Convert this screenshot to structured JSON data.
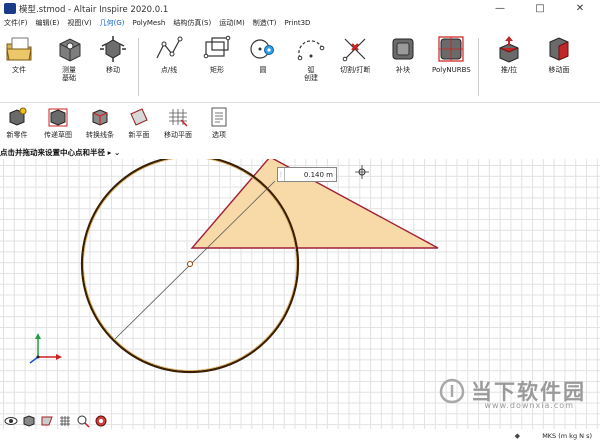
{
  "window": {
    "title": "模型.stmod - Altair Inspire 2020.0.1",
    "minimize": "—",
    "maximize": "□",
    "close": "✕"
  },
  "menu": [
    {
      "label": "文件(F)",
      "active": false
    },
    {
      "label": "编辑(E)",
      "active": false
    },
    {
      "label": "视图(V)",
      "active": false
    },
    {
      "label": "几何(G)",
      "active": true
    },
    {
      "label": "PolyMesh",
      "active": false
    },
    {
      "label": "结构仿真(S)",
      "active": false
    },
    {
      "label": "运动(M)",
      "active": false
    },
    {
      "label": "制造(T)",
      "active": false
    },
    {
      "label": "Print3D",
      "active": false
    }
  ],
  "ribbon": [
    {
      "label": "文件",
      "icon": "file-folder-icon"
    },
    {
      "label": "测量\n基础",
      "icon": "measure-icon"
    },
    {
      "label": "移动",
      "icon": "move-icon"
    },
    {
      "label": "点/线",
      "icon": "point-line-icon"
    },
    {
      "label": "矩形",
      "icon": "rectangle-icon"
    },
    {
      "label": "圆",
      "icon": "circle-icon"
    },
    {
      "label": "弧\n创建",
      "icon": "arc-icon"
    },
    {
      "label": "切割/打断",
      "icon": "trim-break-icon"
    },
    {
      "label": "补块",
      "icon": "patch-icon"
    },
    {
      "label": "PolyNURBS",
      "icon": "polynurbs-icon"
    },
    {
      "label": "推/拉",
      "icon": "push-pull-icon"
    },
    {
      "label": "移动面",
      "icon": "move-face-icon"
    }
  ],
  "subtools": [
    {
      "label": "新零件",
      "icon": "new-part-icon"
    },
    {
      "label": "传递草图",
      "icon": "transfer-sketch-icon"
    },
    {
      "label": "转换线条",
      "icon": "convert-lines-icon"
    },
    {
      "label": "新平面",
      "icon": "new-plane-icon"
    },
    {
      "label": "移动平面",
      "icon": "move-plane-icon"
    },
    {
      "label": "选项",
      "icon": "options-icon"
    }
  ],
  "hint": "点击并拖动来设置中心点和半径 ▸  ⌄",
  "dimension": {
    "value": "0.140 m"
  },
  "units": "MKS (m kg N s)",
  "units_arrow": "◆",
  "watermark": {
    "text": "当下软件园",
    "sub": "www.downxia.com"
  },
  "colors": {
    "triangle_fill": "#f8d9a8",
    "triangle_stroke": "#a0203a",
    "circle_stroke": "#3a2000",
    "accent": "#1a8ad8"
  }
}
